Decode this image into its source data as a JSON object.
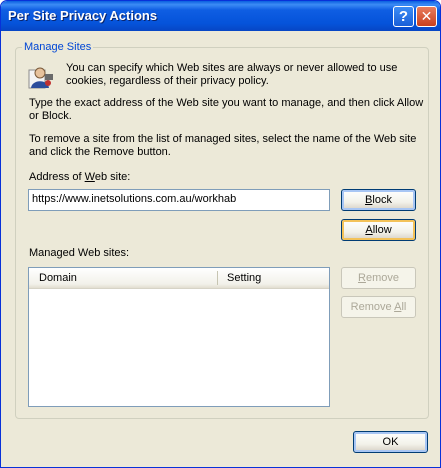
{
  "window": {
    "title": "Per Site Privacy Actions",
    "help_glyph": "?",
    "close_glyph": "✕"
  },
  "group": {
    "legend": "Manage Sites",
    "intro": "You can specify which Web sites are always or never allowed to use cookies, regardless of their privacy policy.",
    "instr1": "Type the exact address of the Web site you want to manage, and then click Allow or Block.",
    "instr2": "To remove a site from the list of managed sites, select the name of the Web site and click the Remove button.",
    "address_label_pre": "Address of ",
    "address_label_u": "W",
    "address_label_post": "eb site:",
    "address_value": "https://www.inetsolutions.com.au/workhab",
    "managed_label": "Managed Web sites:",
    "columns": [
      "Domain",
      "Setting"
    ],
    "rows": []
  },
  "buttons": {
    "block_u": "B",
    "block_rest": "lock",
    "allow_u": "A",
    "allow_rest": "llow",
    "remove_u": "R",
    "remove_rest": "emove",
    "removeall_pre": "Remove ",
    "removeall_u": "A",
    "removeall_rest": "ll",
    "ok": "OK"
  },
  "icons": {
    "privacy": "privacy-user-icon"
  },
  "colors": {
    "titlebar": "#0553da",
    "legend": "#0046d5",
    "face": "#ece9d8"
  }
}
